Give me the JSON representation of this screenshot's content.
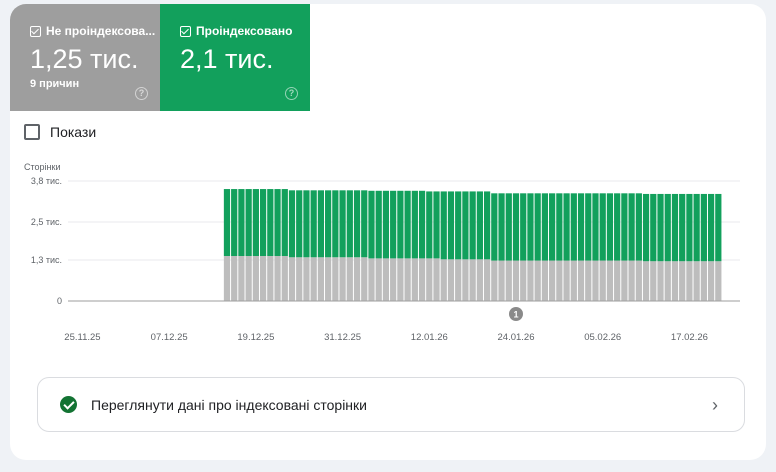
{
  "tiles": [
    {
      "label": "Не проіндексова...",
      "value": "1,25 тис.",
      "sub": "9 причин",
      "checked": true,
      "color": "#9e9e9e"
    },
    {
      "label": "Проіндексовано",
      "value": "2,1 тис.",
      "checked": true,
      "color": "#12a05c"
    }
  ],
  "impressions": {
    "label": "Покази",
    "checked": false
  },
  "link": {
    "label": "Переглянути дані про індексовані сторінки",
    "icon": "check-circle-icon"
  },
  "chart_data": {
    "type": "bar",
    "stacked": true,
    "ylabel": "Сторінки",
    "ylim": [
      0,
      3800
    ],
    "yticks": [
      {
        "v": 0,
        "label": "0"
      },
      {
        "v": 1300,
        "label": "1,3 тис."
      },
      {
        "v": 2500,
        "label": "2,5 тис."
      },
      {
        "v": 3800,
        "label": "3,8 тис."
      }
    ],
    "xlim": [
      "23.11.25",
      "24.02.26"
    ],
    "xticks": [
      "25.11.25",
      "07.12.25",
      "19.12.25",
      "31.12.25",
      "12.01.26",
      "24.01.26",
      "05.02.26",
      "17.02.26"
    ],
    "annotations": [
      {
        "date": "24.01.26",
        "label": "1"
      }
    ],
    "grid": true,
    "categories": [
      "15.12.25",
      "16.12.25",
      "17.12.25",
      "18.12.25",
      "19.12.25",
      "20.12.25",
      "21.12.25",
      "22.12.25",
      "23.12.25",
      "24.12.25",
      "25.12.25",
      "26.12.25",
      "27.12.25",
      "28.12.25",
      "29.12.25",
      "30.12.25",
      "31.12.25",
      "01.01.26",
      "02.01.26",
      "03.01.26",
      "04.01.26",
      "05.01.26",
      "06.01.26",
      "07.01.26",
      "08.01.26",
      "09.01.26",
      "10.01.26",
      "11.01.26",
      "12.01.26",
      "13.01.26",
      "14.01.26",
      "15.01.26",
      "16.01.26",
      "17.01.26",
      "18.01.26",
      "19.01.26",
      "20.01.26",
      "21.01.26",
      "22.01.26",
      "23.01.26",
      "24.01.26",
      "25.01.26",
      "26.01.26",
      "27.01.26",
      "28.01.26",
      "29.01.26",
      "30.01.26",
      "31.01.26",
      "01.02.26",
      "02.02.26",
      "03.02.26",
      "04.02.26",
      "05.02.26",
      "06.02.26",
      "07.02.26",
      "08.02.26",
      "09.02.26",
      "10.02.26",
      "11.02.26",
      "12.02.26",
      "13.02.26",
      "14.02.26",
      "15.02.26",
      "16.02.26",
      "17.02.26",
      "18.02.26",
      "19.02.26",
      "20.02.26",
      "21.02.26"
    ],
    "series": [
      {
        "name": "Не проіндексовано",
        "color": "#bdbdbd",
        "values": [
          1425,
          1425,
          1425,
          1425,
          1425,
          1425,
          1425,
          1425,
          1425,
          1385,
          1385,
          1385,
          1385,
          1385,
          1385,
          1385,
          1385,
          1385,
          1385,
          1385,
          1350,
          1350,
          1350,
          1350,
          1350,
          1350,
          1350,
          1350,
          1350,
          1350,
          1320,
          1320,
          1320,
          1320,
          1320,
          1320,
          1320,
          1280,
          1280,
          1280,
          1280,
          1280,
          1280,
          1280,
          1280,
          1280,
          1280,
          1280,
          1280,
          1280,
          1280,
          1280,
          1280,
          1280,
          1280,
          1280,
          1280,
          1280,
          1260,
          1260,
          1260,
          1260,
          1260,
          1260,
          1260,
          1260,
          1260,
          1260,
          1260
        ]
      },
      {
        "name": "Проіндексовано",
        "color": "#12a05c",
        "values": [
          2120,
          2120,
          2120,
          2120,
          2120,
          2120,
          2120,
          2120,
          2120,
          2120,
          2120,
          2120,
          2120,
          2120,
          2120,
          2120,
          2120,
          2120,
          2120,
          2120,
          2140,
          2140,
          2140,
          2140,
          2140,
          2140,
          2140,
          2140,
          2120,
          2120,
          2150,
          2150,
          2150,
          2150,
          2150,
          2150,
          2150,
          2130,
          2130,
          2130,
          2130,
          2130,
          2130,
          2130,
          2130,
          2130,
          2130,
          2130,
          2130,
          2130,
          2130,
          2130,
          2130,
          2130,
          2130,
          2130,
          2130,
          2130,
          2130,
          2130,
          2130,
          2130,
          2130,
          2130,
          2130,
          2130,
          2130,
          2130,
          2130
        ]
      }
    ]
  }
}
